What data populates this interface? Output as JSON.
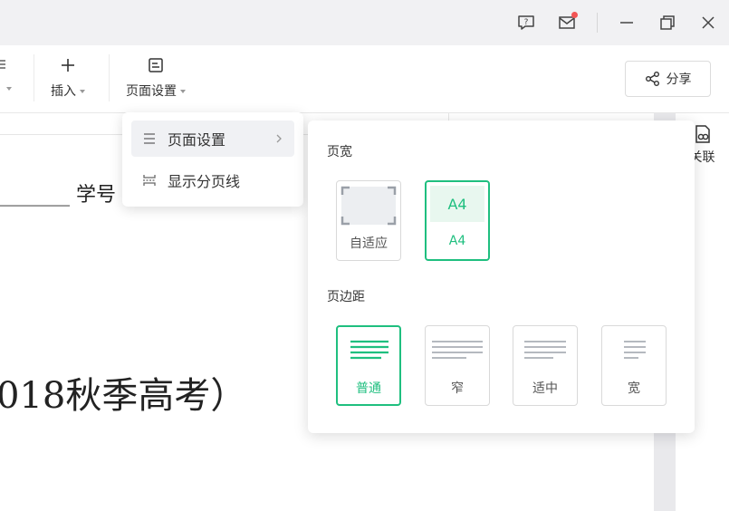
{
  "window": {
    "icons": [
      "help-icon",
      "mail-icon",
      "minimize-icon",
      "restore-icon",
      "close-icon"
    ]
  },
  "toolbar": {
    "insert_label": "插入",
    "page_setup_label": "页面设置",
    "share_label": "分享"
  },
  "document": {
    "line1": "_______  学号",
    "line2": "018秋季高考）"
  },
  "side_panel": {
    "link_label": "关联"
  },
  "menu": {
    "items": [
      {
        "label": "页面设置",
        "icon": "list-icon",
        "has_submenu": true,
        "active": true
      },
      {
        "label": "显示分页线",
        "icon": "page-break-icon",
        "has_submenu": false,
        "active": false
      }
    ]
  },
  "page_setup_panel": {
    "width_title": "页宽",
    "width_options": [
      {
        "label": "自适应",
        "selected": false
      },
      {
        "label": "A4",
        "preview_text": "A4",
        "selected": true
      }
    ],
    "margin_title": "页边距",
    "margin_options": [
      {
        "label": "普通",
        "selected": true
      },
      {
        "label": "窄",
        "selected": false
      },
      {
        "label": "适中",
        "selected": false
      },
      {
        "label": "宽",
        "selected": false
      }
    ]
  },
  "colors": {
    "accent": "#1fbf7f",
    "notify_dot": "#f25555",
    "titlebar_bg": "#f1f1f3"
  }
}
